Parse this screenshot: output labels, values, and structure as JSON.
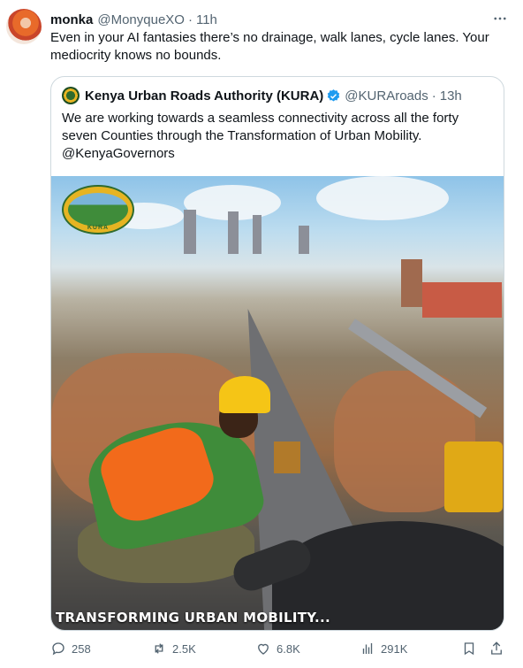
{
  "tweet": {
    "author_name": "monka",
    "author_handle": "@MonyqueXO",
    "separator": "·",
    "time": "11h",
    "text": "Even in your AI fantasies there’s no drainage, walk lanes, cycle lanes. Your mediocrity knows no bounds."
  },
  "quoted_tweet": {
    "author_name": "Kenya Urban Roads Authority (KURA)",
    "author_handle": "@KURAroads",
    "separator": "·",
    "time": "13h",
    "text": "We are working towards a seamless connectivity across all the forty seven Counties through the Transformation of Urban Mobility. @KenyaGovernors",
    "media": {
      "logo_text": "KURA",
      "caption": "TRANSFORMING URBAN MOBILITY..."
    }
  },
  "actions": {
    "replies": "258",
    "reposts": "2.5K",
    "likes": "6.8K",
    "views": "291K"
  },
  "icons": {
    "verified": "verified-badge-icon",
    "more": "more-options-icon",
    "reply": "reply-icon",
    "repost": "repost-icon",
    "like": "heart-icon",
    "views": "views-chart-icon",
    "bookmark": "bookmark-icon",
    "share": "share-icon"
  },
  "colors": {
    "text_primary": "#0f1419",
    "text_secondary": "#536471",
    "border": "#cfd9de",
    "verified_blue": "#1d9bf0"
  }
}
